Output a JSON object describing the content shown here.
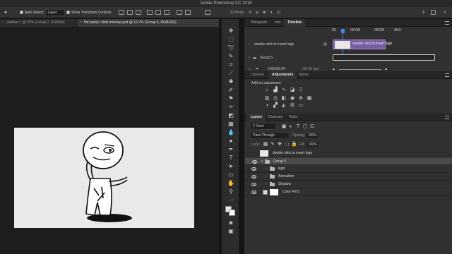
{
  "app": {
    "title": "Adobe Photoshop CC 2018"
  },
  "options_bar": {
    "auto_select_label": "Auto-Select:",
    "auto_select_value": "Layer",
    "show_transform_label": "Show Transform Controls",
    "mode_label": "3D Mode:"
  },
  "document_tabs": [
    {
      "label": "Untitled-1 @ 25% (Group 2, RGB/8#)"
    },
    {
      "label": "flat pump t shirt mockup.psd @ 16.7% (Group 5, RGB/16#)"
    }
  ],
  "tools": [
    "move",
    "marquee",
    "lasso",
    "quick-select",
    "crop",
    "eyedropper",
    "healing",
    "brush",
    "clone",
    "history",
    "eraser",
    "gradient",
    "blur",
    "dodge",
    "pen",
    "type",
    "path-select",
    "rectangle",
    "hand",
    "zoom",
    "more",
    "colors",
    "quick-mask",
    "screen-mode"
  ],
  "timeline_panel": {
    "tabs": [
      "Histogram",
      "Info",
      "Timeline"
    ],
    "ruler": [
      "00",
      "02:00f",
      "04:00f",
      "06:0"
    ],
    "track_label": "double click to insert logo",
    "group_label": "Group 5",
    "timecode": "0:00:00:24",
    "fps": "(30.00 fps)"
  },
  "adjustments_panel": {
    "tabs": [
      "Libraries",
      "Adjustments",
      "Styles"
    ],
    "prompt": "Add an adjustment"
  },
  "layers_panel": {
    "tabs": [
      "Layers",
      "Channels",
      "Paths"
    ],
    "filter_label": "Kind",
    "blend_mode": "Pass Through",
    "opacity_label": "Opacity:",
    "opacity_value": "100%",
    "lock_label": "Lock:",
    "fill_label": "Fill:",
    "fill_value": "100%",
    "layers": [
      {
        "name": "double click to insert logo",
        "type": "smart",
        "selected": false
      },
      {
        "name": "Group 5",
        "type": "group",
        "selected": true
      },
      {
        "name": "logo",
        "type": "group",
        "selected": false
      },
      {
        "name": "Animation",
        "type": "group",
        "selected": false
      },
      {
        "name": "Shadow",
        "type": "group",
        "selected": false
      },
      {
        "name": "Color Fill 1",
        "type": "fill",
        "selected": false
      }
    ]
  },
  "colors": {
    "timeline_track": "#7a5ea3",
    "playhead": "#3d8ee8",
    "canvas_bg": "#e9e9e9"
  }
}
